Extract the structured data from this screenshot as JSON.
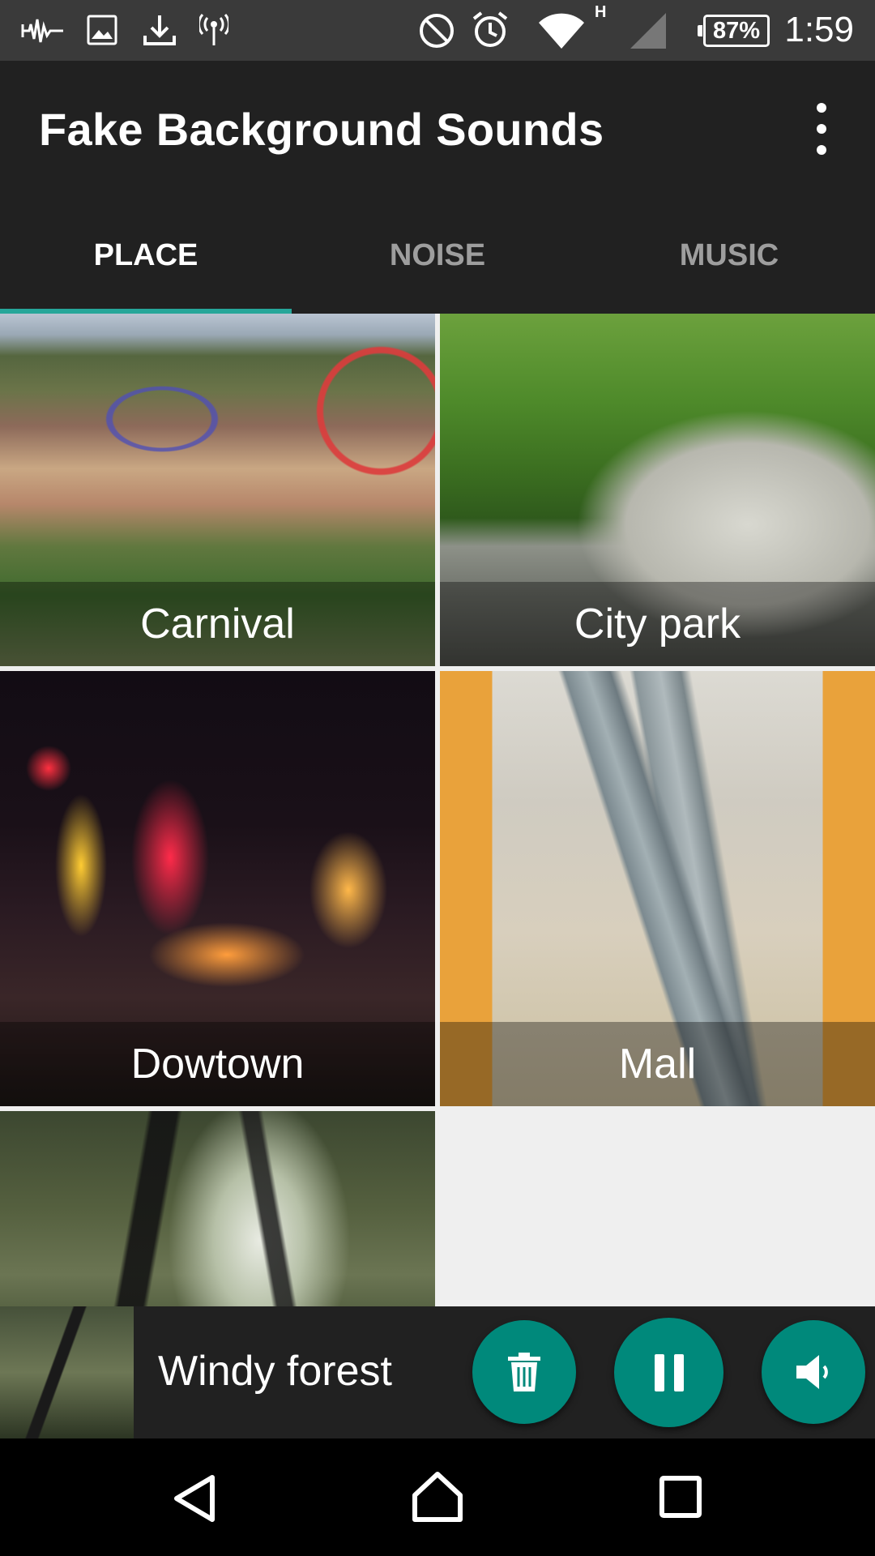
{
  "status_bar": {
    "network_type": "H",
    "battery_percent": "87%",
    "time": "1:59",
    "icons": [
      "audio-wave-icon",
      "image-icon",
      "download-icon",
      "hotspot-icon",
      "do-not-disturb-icon",
      "alarm-icon",
      "wifi-icon",
      "cell-signal-icon",
      "battery-icon"
    ]
  },
  "app_bar": {
    "title": "Fake Background Sounds",
    "menu_icon": "more-vertical-icon"
  },
  "tabs": [
    {
      "label": "PLACE",
      "active": true
    },
    {
      "label": "NOISE",
      "active": false
    },
    {
      "label": "MUSIC",
      "active": false
    }
  ],
  "places": [
    {
      "label": "Carnival"
    },
    {
      "label": "City park"
    },
    {
      "label": "Dowtown"
    },
    {
      "label": "Mall"
    }
  ],
  "player": {
    "title": "Windy forest",
    "buttons": [
      "delete-icon",
      "pause-icon",
      "volume-icon"
    ]
  },
  "nav_bar": {
    "buttons": [
      "back-icon",
      "home-icon",
      "recents-icon"
    ]
  },
  "colors": {
    "accent": "#26a69a",
    "fab": "#00897b",
    "background": "#212121"
  }
}
